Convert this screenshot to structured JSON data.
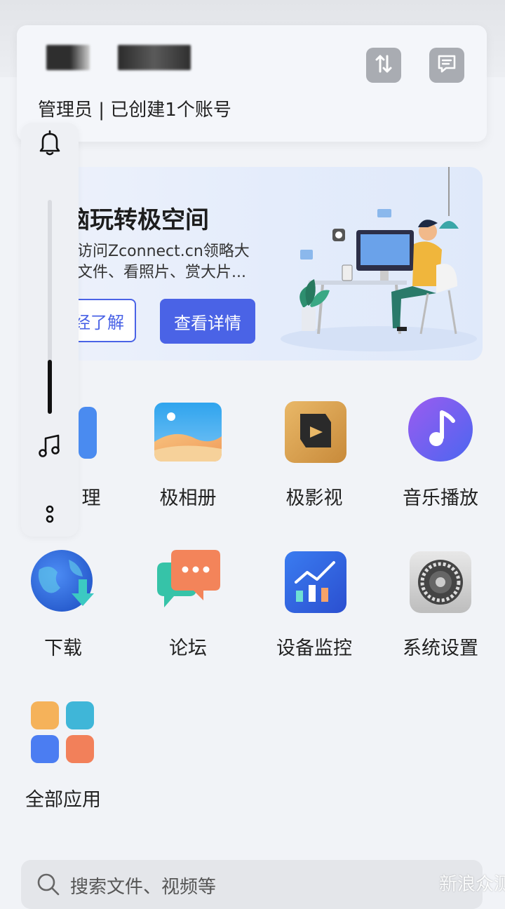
{
  "header": {
    "role_text": "管理员 | 已创建1个账号",
    "icons": [
      "sort-icon",
      "message-icon"
    ]
  },
  "banner": {
    "title": "玩转极空间",
    "title_partial": "脑玩转极空间",
    "desc_line1": "访问Zconnect.cn领略大",
    "desc_line2": "文件、看照片、赏大片...",
    "learn_button": "经了解",
    "detail_button": "查看详情",
    "colors": {
      "accent": "#4a63e6"
    }
  },
  "side_rail": {
    "icons": [
      "bell-icon",
      "music-note-icon",
      "more-vertical-icon"
    ],
    "slider_level": 0.25
  },
  "apps": [
    {
      "label": "理",
      "icon": "file-manager-icon"
    },
    {
      "label": "极相册",
      "icon": "album-icon"
    },
    {
      "label": "极影视",
      "icon": "video-icon"
    },
    {
      "label": "音乐播放",
      "icon": "music-player-icon"
    },
    {
      "label": "下载",
      "icon": "download-globe-icon"
    },
    {
      "label": "论坛",
      "icon": "forum-icon"
    },
    {
      "label": "设备监控",
      "icon": "monitor-chart-icon"
    },
    {
      "label": "系统设置",
      "icon": "settings-gear-icon"
    },
    {
      "label": "全部应用",
      "icon": "all-apps-icon"
    }
  ],
  "search": {
    "placeholder": "搜索文件、视频等"
  },
  "watermark": "新浪众测"
}
